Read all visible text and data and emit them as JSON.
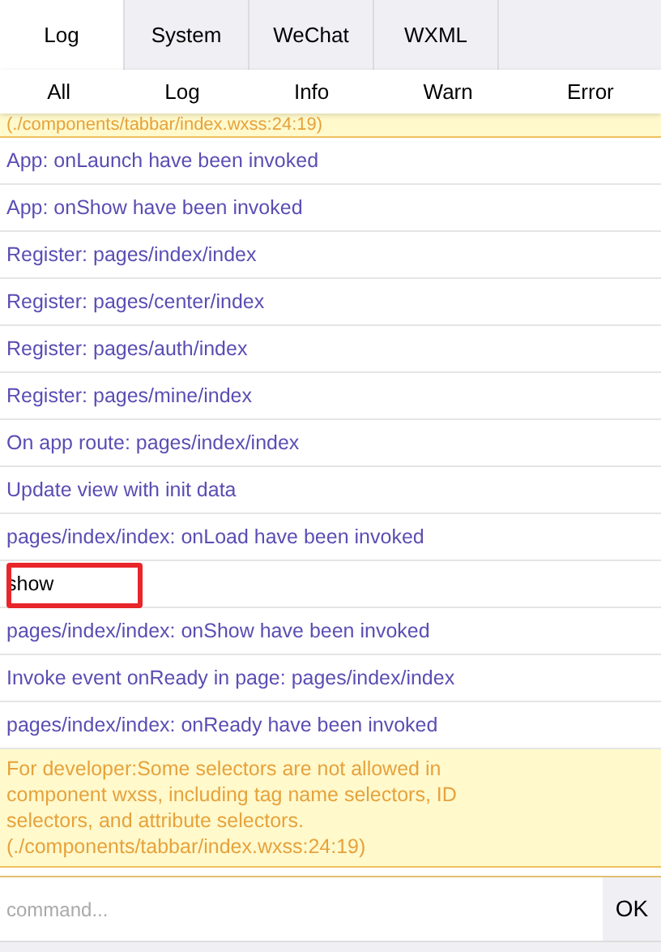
{
  "tabs": [
    {
      "label": "Log",
      "selected": true
    },
    {
      "label": "System",
      "selected": false
    },
    {
      "label": "WeChat",
      "selected": false
    },
    {
      "label": "WXML",
      "selected": false
    }
  ],
  "filters": [
    {
      "label": "All"
    },
    {
      "label": "Log"
    },
    {
      "label": "Info"
    },
    {
      "label": "Warn"
    },
    {
      "label": "Error"
    }
  ],
  "entries": [
    {
      "kind": "warn",
      "text": "(./components/tabbar/index.wxss:24:19)"
    },
    {
      "kind": "info",
      "text": "App: onLaunch have been invoked"
    },
    {
      "kind": "info",
      "text": "App: onShow have been invoked"
    },
    {
      "kind": "info",
      "text": "Register: pages/index/index"
    },
    {
      "kind": "info",
      "text": "Register: pages/center/index"
    },
    {
      "kind": "info",
      "text": "Register: pages/auth/index"
    },
    {
      "kind": "info",
      "text": "Register: pages/mine/index"
    },
    {
      "kind": "info",
      "text": "On app route: pages/index/index"
    },
    {
      "kind": "info",
      "text": "Update view with init data"
    },
    {
      "kind": "info",
      "text": "pages/index/index: onLoad have been invoked"
    },
    {
      "kind": "log",
      "text": "show"
    },
    {
      "kind": "info",
      "text": "pages/index/index: onShow have been invoked"
    },
    {
      "kind": "info",
      "text": "Invoke event onReady in page: pages/index/index"
    },
    {
      "kind": "info",
      "text": "pages/index/index: onReady have been invoked"
    },
    {
      "kind": "warn",
      "text": "For developer:Some selectors are not allowed in component wxss, including tag name selectors, ID selectors, and attribute selectors. (./components/tabbar/index.wxss:24:19)"
    }
  ],
  "command": {
    "placeholder": "command...",
    "button": "OK"
  }
}
